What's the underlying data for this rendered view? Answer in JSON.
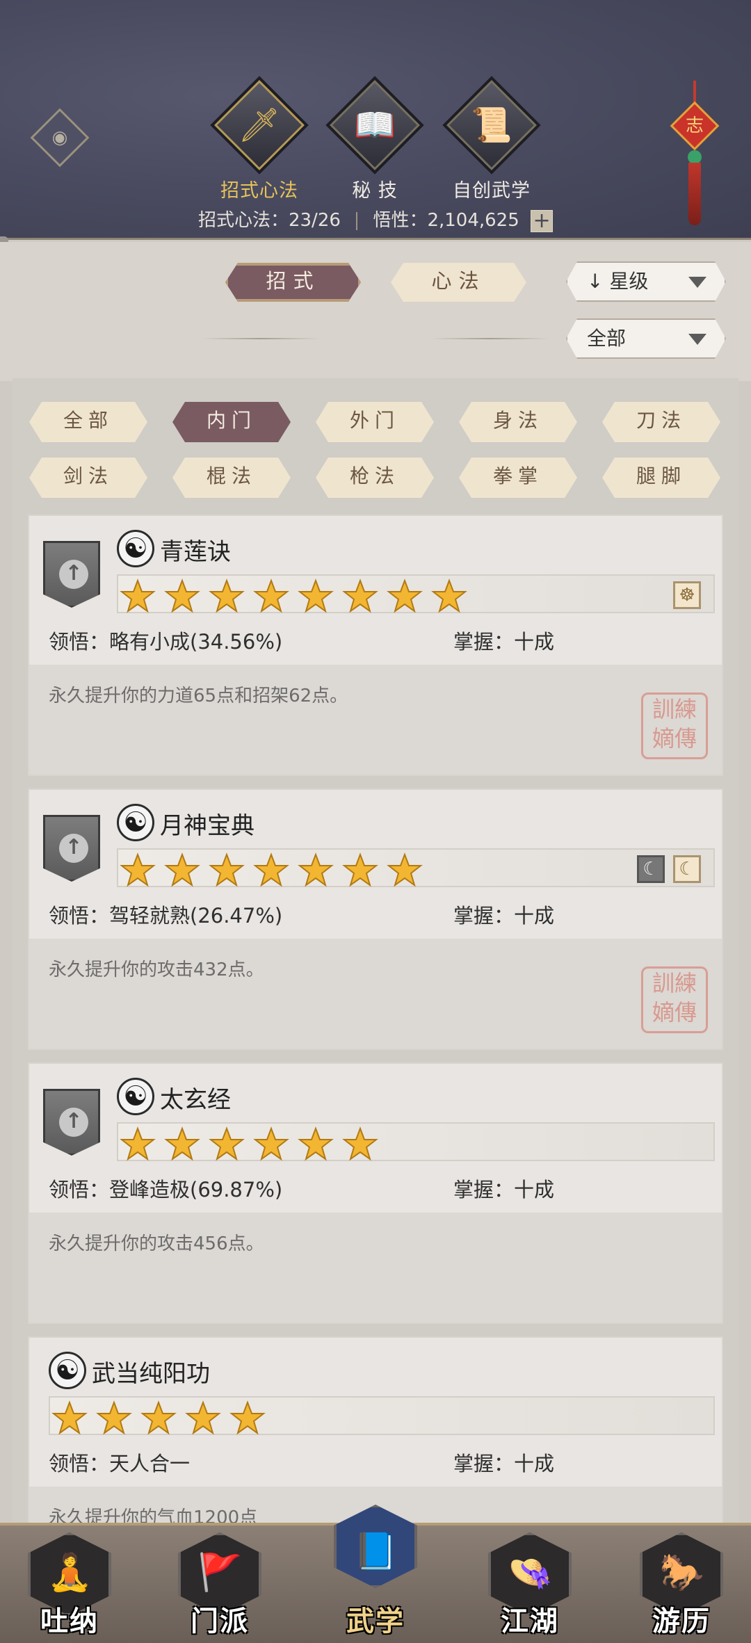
{
  "header": {
    "tabs": [
      {
        "label": "招式心法",
        "icon": "sword-icon",
        "glyph": "🗡",
        "active": true
      },
      {
        "label": "秘 技",
        "icon": "book-icon",
        "glyph": "📖",
        "active": false
      },
      {
        "label": "自创武学",
        "icon": "scroll-icon",
        "glyph": "📜",
        "active": false
      }
    ],
    "stats_label": "招式心法：23/26",
    "insight_label": "悟性：2,104,625",
    "plus": "+",
    "knot_char": "志"
  },
  "segment": {
    "tab1": "招式",
    "tab2": "心法"
  },
  "sort": {
    "selected": "星级",
    "filter": "全部"
  },
  "filters": [
    "全部",
    "内门",
    "外门",
    "身法",
    "刀法",
    "剑法",
    "棍法",
    "枪法",
    "拳掌",
    "腿脚"
  ],
  "active_filter": "内门",
  "skills": [
    {
      "name": "青莲诀",
      "stars": 8,
      "comprehension": "领悟：略有小成(34.56%)",
      "mastery": "掌握：十成",
      "desc": "永久提升你的力道65点和招架62点。",
      "seal": "訓練\n嫡傳"
    },
    {
      "name": "月神宝典",
      "stars": 7,
      "comprehension": "领悟：驾轻就熟(26.47%)",
      "mastery": "掌握：十成",
      "desc": "永久提升你的攻击432点。",
      "seal": "訓練\n嫡傳"
    },
    {
      "name": "太玄经",
      "stars": 6,
      "comprehension": "领悟：登峰造极(69.87%)",
      "mastery": "掌握：十成",
      "desc": "永久提升你的攻击456点。"
    },
    {
      "name": "武当纯阳功",
      "stars": 5,
      "comprehension": "领悟：天人合一",
      "mastery": "掌握：十成",
      "desc": "永久提升你的气血1200点"
    }
  ],
  "nav": [
    {
      "label": "吐纳",
      "icon": "monk-icon"
    },
    {
      "label": "门派",
      "icon": "banner-icon"
    },
    {
      "label": "武学",
      "icon": "manual-icon",
      "active": true
    },
    {
      "label": "江湖",
      "icon": "straw-hat-icon"
    },
    {
      "label": "游历",
      "icon": "horse-icon"
    }
  ],
  "colors": {
    "accent": "#7a5b62",
    "header_bg": "#4a4b60",
    "star": "#f2b632"
  }
}
